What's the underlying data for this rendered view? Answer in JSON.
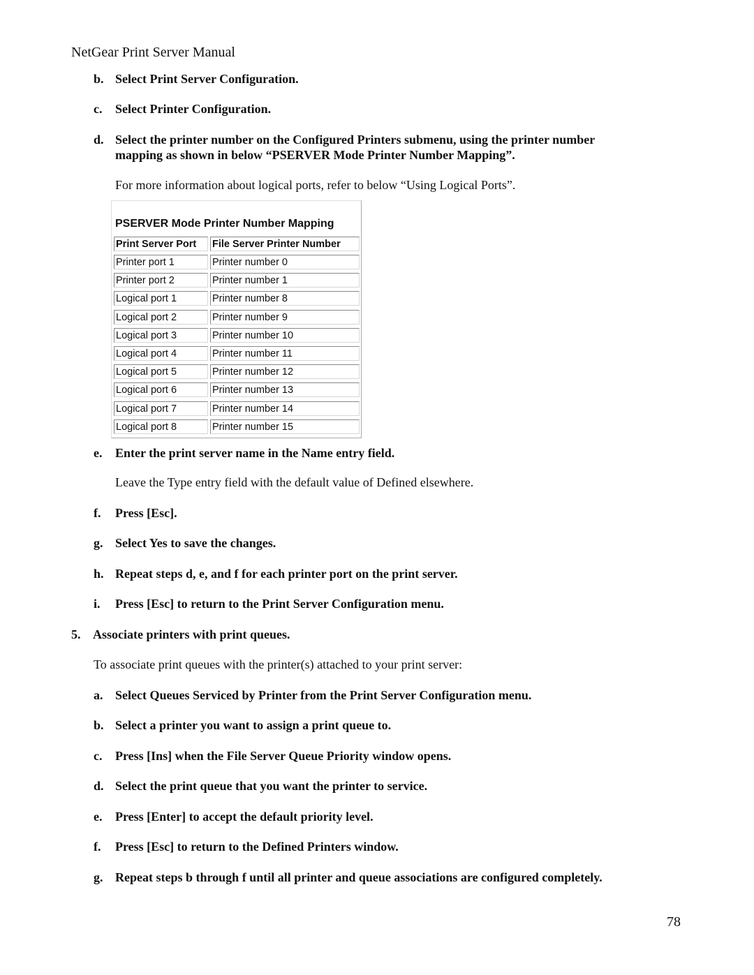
{
  "header": {
    "title": "NetGear Print Server Manual"
  },
  "steps_top": [
    {
      "label": "b.",
      "text": "Select Print Server Configuration."
    },
    {
      "label": "c.",
      "text": "Select Printer Configuration."
    },
    {
      "label": "d.",
      "text": "Select the printer number on the Configured Printers submenu, using the printer number",
      "text2": "mapping as shown in below “PSERVER Mode Printer Number Mapping”."
    }
  ],
  "note_logical_ports": "For more information about logical ports, refer to below “Using Logical Ports”.",
  "table": {
    "caption": "PSERVER Mode Printer Number Mapping",
    "columns": [
      "Print Server Port",
      "File Server Printer Number"
    ],
    "rows": [
      [
        "Printer port 1",
        "Printer number 0"
      ],
      [
        "Printer port 2",
        "Printer number 1"
      ],
      [
        "Logical port 1",
        "Printer number 8"
      ],
      [
        "Logical port 2",
        "Printer number 9"
      ],
      [
        "Logical port 3",
        "Printer number 10"
      ],
      [
        "Logical port 4",
        "Printer number 11"
      ],
      [
        "Logical port 5",
        "Printer number 12"
      ],
      [
        "Logical port 6",
        "Printer number 13"
      ],
      [
        "Logical port 7",
        "Printer number 14"
      ],
      [
        "Logical port 8",
        "Printer number 15"
      ]
    ]
  },
  "steps_mid": [
    {
      "label": "e.",
      "text": "Enter the print server name in the Name entry field."
    },
    {
      "label": "f.",
      "text": "Press [Esc]."
    },
    {
      "label": "g.",
      "text": "Select Yes to save the changes."
    },
    {
      "label": "h.",
      "text": "Repeat steps d, e, and f for each printer port on the print server."
    },
    {
      "label": "i.",
      "text": "Press [Esc] to return to the Print Server Configuration menu."
    }
  ],
  "note_type_field": "Leave the Type entry field with the default value of Defined elsewhere.",
  "step5": {
    "label": "5.",
    "text": "Associate printers with print queues."
  },
  "note_associate": "To associate print queues with the printer(s) attached to your print server:",
  "steps_bottom": [
    {
      "label": "a.",
      "text": "Select Queues Serviced by Printer from the Print Server Configuration menu."
    },
    {
      "label": "b.",
      "text": "Select a printer you want to assign a print queue to."
    },
    {
      "label": "c.",
      "text": "Press [Ins] when the File Server Queue Priority window opens."
    },
    {
      "label": "d.",
      "text": "Select the print queue that you want the printer to service."
    },
    {
      "label": "e.",
      "text": "Press [Enter] to accept the default priority level."
    },
    {
      "label": "f.",
      "text": "Press [Esc] to return to the Defined Printers window."
    },
    {
      "label": "g.",
      "text": "Repeat steps b through f until all printer and queue associations are configured completely."
    }
  ],
  "page_number": "78"
}
